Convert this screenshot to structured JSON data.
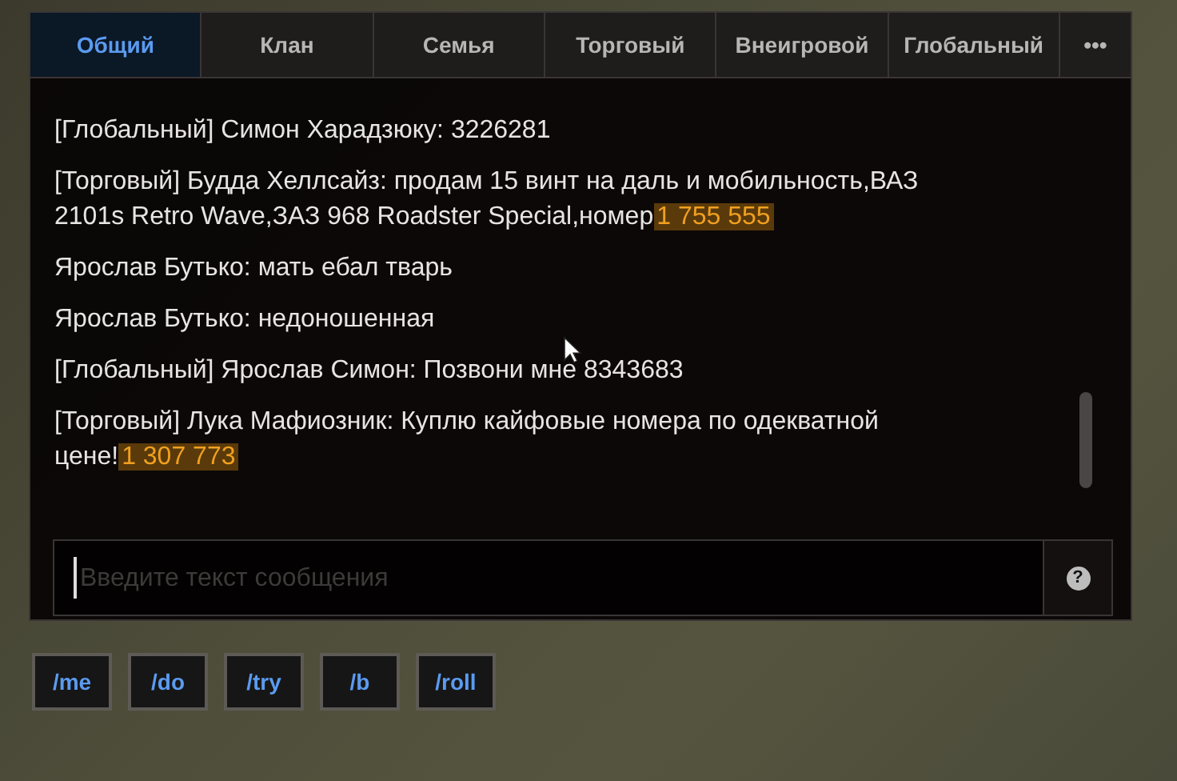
{
  "tabs": [
    {
      "label": "Общий",
      "selected": true
    },
    {
      "label": "Клан",
      "selected": false
    },
    {
      "label": "Семья",
      "selected": false
    },
    {
      "label": "Торговый",
      "selected": false
    },
    {
      "label": "Внеигровой",
      "selected": false
    },
    {
      "label": "Глобальный",
      "selected": false
    },
    {
      "label": "•••",
      "selected": false
    }
  ],
  "messages": [
    {
      "text": "[Глобальный] Симон Харадзюку: 3226281"
    },
    {
      "text": "[Торговый] Будда Хеллсайз: продам 15 винт на даль и мобильность,ВАЗ 2101s Retro Wave,ЗАЗ 968 Roadster Special,номер",
      "price": "1 755 555"
    },
    {
      "text": "Ярослав Бутько: мать ебал тварь"
    },
    {
      "text": "Ярослав Бутько: недоношенная"
    },
    {
      "text": "[Глобальный] Ярослав Симон: Позвони мне 8343683"
    },
    {
      "text": "[Торговый] Лука Мафиозник: Куплю кайфовые номера по одекватной цене!",
      "price": "1 307 773"
    }
  ],
  "input": {
    "placeholder": "Введите текст сообщения",
    "help": "?"
  },
  "commands": [
    "/me",
    "/do",
    "/try",
    "/b",
    "/roll"
  ]
}
